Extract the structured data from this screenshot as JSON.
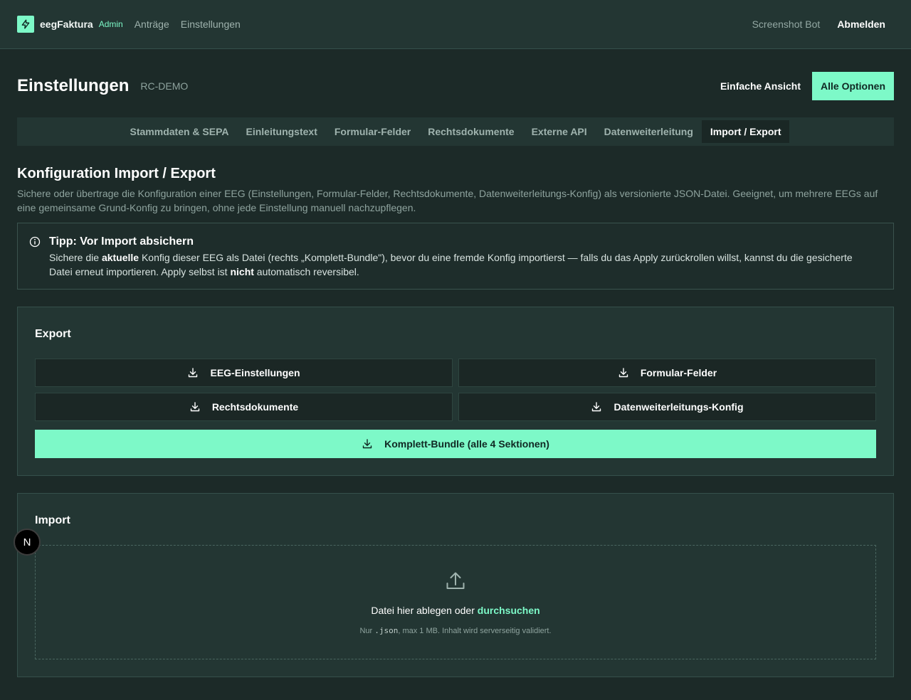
{
  "header": {
    "brand": "eegFaktura",
    "badge": "Admin",
    "nav": [
      "Anträge",
      "Einstellungen"
    ],
    "user": "Screenshot Bot",
    "logout": "Abmelden"
  },
  "page": {
    "title": "Einstellungen",
    "subtitle": "RC-DEMO",
    "view_simple": "Einfache Ansicht",
    "view_all": "Alle Optionen"
  },
  "tabs": [
    {
      "label": "Stammdaten & SEPA",
      "active": false
    },
    {
      "label": "Einleitungstext",
      "active": false
    },
    {
      "label": "Formular-Felder",
      "active": false
    },
    {
      "label": "Rechtsdokumente",
      "active": false
    },
    {
      "label": "Externe API",
      "active": false
    },
    {
      "label": "Datenweiterleitung",
      "active": false
    },
    {
      "label": "Import / Export",
      "active": true
    }
  ],
  "section": {
    "title": "Konfiguration Import / Export",
    "description": "Sichere oder übertrage die Konfiguration einer EEG (Einstellungen, Formular-Felder, Rechtsdokumente, Datenweiterleitungs-Konfig) als versionierte JSON-Datei. Geeignet, um mehrere EEGs auf eine gemeinsame Grund-Konfig zu bringen, ohne jede Einstellung manuell nachzupflegen."
  },
  "tip": {
    "title": "Tipp: Vor Import absichern",
    "t1": "Sichere die ",
    "b1": "aktuelle",
    "t2": " Konfig dieser EEG als Datei (rechts „Komplett-Bundle\"), bevor du eine fremde Konfig importierst — falls du das Apply zurückrollen willst, kannst du die gesicherte Datei erneut importieren. Apply selbst ist ",
    "b2": "nicht",
    "t3": " automatisch reversibel."
  },
  "export": {
    "title": "Export",
    "buttons": [
      "EEG-Einstellungen",
      "Formular-Felder",
      "Rechtsdokumente",
      "Datenweiterleitungs-Konfig"
    ],
    "bundle": "Komplett-Bundle (alle 4 Sektionen)"
  },
  "import": {
    "title": "Import",
    "drop_text": "Datei hier ablegen oder ",
    "drop_link": "durchsuchen",
    "hint_pre": "Nur ",
    "hint_code": ".json",
    "hint_post": ", max 1 MB. Inhalt wird serverseitig validiert."
  },
  "floating_badge": "N",
  "colors": {
    "accent": "#7df9c8",
    "background": "#1c2a28",
    "card": "#233633"
  },
  "icons": [
    "bolt-icon",
    "info-icon",
    "download-icon",
    "upload-icon"
  ]
}
